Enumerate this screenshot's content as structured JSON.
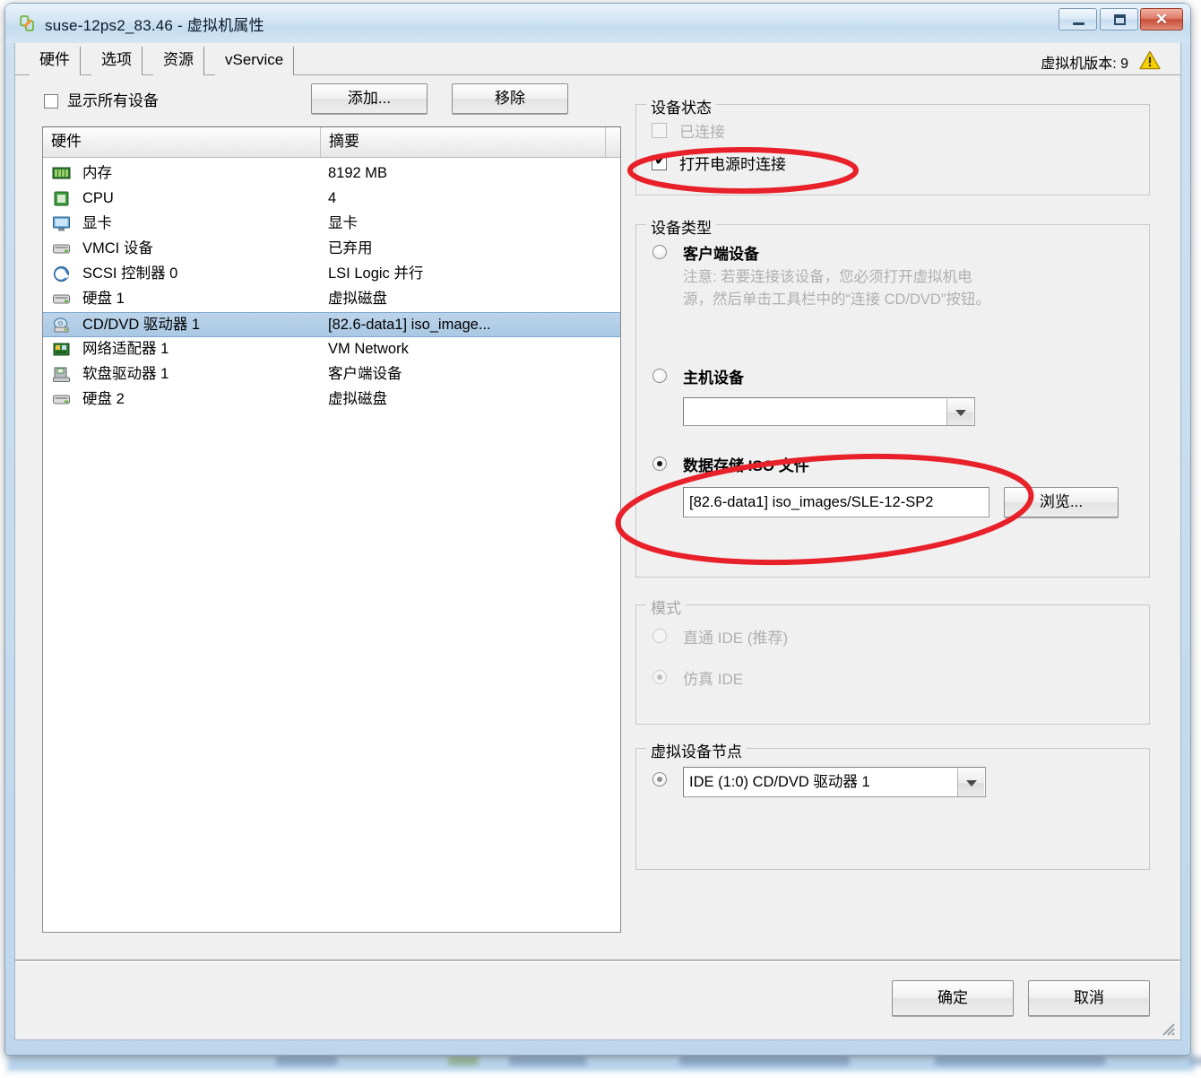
{
  "window": {
    "title": "suse-12ps2_83.46 - 虚拟机属性",
    "icon": "vmware-vm-icon",
    "controls": {
      "minimize": "最小化",
      "maximize": "最大化",
      "close": "关闭"
    }
  },
  "tabs": [
    {
      "id": "hardware",
      "label": "硬件",
      "selected": true
    },
    {
      "id": "options",
      "label": "选项",
      "selected": false
    },
    {
      "id": "resources",
      "label": "资源",
      "selected": false
    },
    {
      "id": "vservice",
      "label": "vService",
      "selected": false
    }
  ],
  "header": {
    "vm_version_label": "虚拟机版本: 9",
    "warning_icon": "warning-triangle-icon"
  },
  "left_panel": {
    "show_all_devices": {
      "label": "显示所有设备",
      "checked": false
    },
    "add_button": "添加...",
    "remove_button": "移除",
    "columns": [
      "硬件",
      "摘要"
    ],
    "rows": [
      {
        "icon": "memory-icon",
        "name": "内存",
        "summary": "8192 MB",
        "selected": false
      },
      {
        "icon": "cpu-icon",
        "name": "CPU",
        "summary": "4",
        "selected": false
      },
      {
        "icon": "display-icon",
        "name": "显卡",
        "summary": "显卡",
        "selected": false
      },
      {
        "icon": "vmci-icon",
        "name": "VMCI 设备",
        "summary": "已弃用",
        "selected": false
      },
      {
        "icon": "scsi-icon",
        "name": "SCSI 控制器  0",
        "summary": "LSI Logic 并行",
        "selected": false
      },
      {
        "icon": "harddisk-icon",
        "name": "硬盘  1",
        "summary": "虚拟磁盘",
        "selected": false
      },
      {
        "icon": "cddvd-icon",
        "name": "CD/DVD 驱动器  1",
        "summary": "[82.6-data1] iso_image...",
        "selected": true
      },
      {
        "icon": "network-icon",
        "name": "网络适配器  1",
        "summary": "VM Network",
        "selected": false
      },
      {
        "icon": "floppy-icon",
        "name": "软盘驱动器  1",
        "summary": "客户端设备",
        "selected": false
      },
      {
        "icon": "harddisk-icon",
        "name": "硬盘  2",
        "summary": "虚拟磁盘",
        "selected": false
      }
    ]
  },
  "right_panel": {
    "device_status": {
      "title": "设备状态",
      "connected": {
        "label": "已连接",
        "checked": false,
        "disabled": true
      },
      "connect_at_power_on": {
        "label": "打开电源时连接",
        "checked": true,
        "disabled": false
      }
    },
    "device_type": {
      "title": "设备类型",
      "client_device": {
        "label": "客户端设备",
        "selected": false
      },
      "client_device_note": "注意: 若要连接该设备，您必须打开虚拟机电\n源，然后单击工具栏中的“连接 CD/DVD”按钮。",
      "host_device": {
        "label": "主机设备",
        "selected": false
      },
      "host_device_value": "",
      "datastore_iso": {
        "label": "数据存储 ISO 文件",
        "selected": true
      },
      "iso_path": "[82.6-data1] iso_images/SLE-12-SP2",
      "browse_button": "浏览..."
    },
    "mode": {
      "title": "模式",
      "disabled": true,
      "passthrough": {
        "label": "直通 IDE (推荐)",
        "selected": false
      },
      "emulate": {
        "label": "仿真 IDE",
        "selected": true
      }
    },
    "virtual_device_node": {
      "title": "虚拟设备节点",
      "selected_option": "IDE (1:0) CD/DVD 驱动器 1"
    }
  },
  "footer": {
    "ok_button": "确定",
    "cancel_button": "取消"
  },
  "annotations": {
    "accent_color": "#e8202a",
    "ellipses": [
      {
        "name": "connect-at-power-on-highlight"
      },
      {
        "name": "datastore-iso-file-highlight"
      }
    ]
  }
}
